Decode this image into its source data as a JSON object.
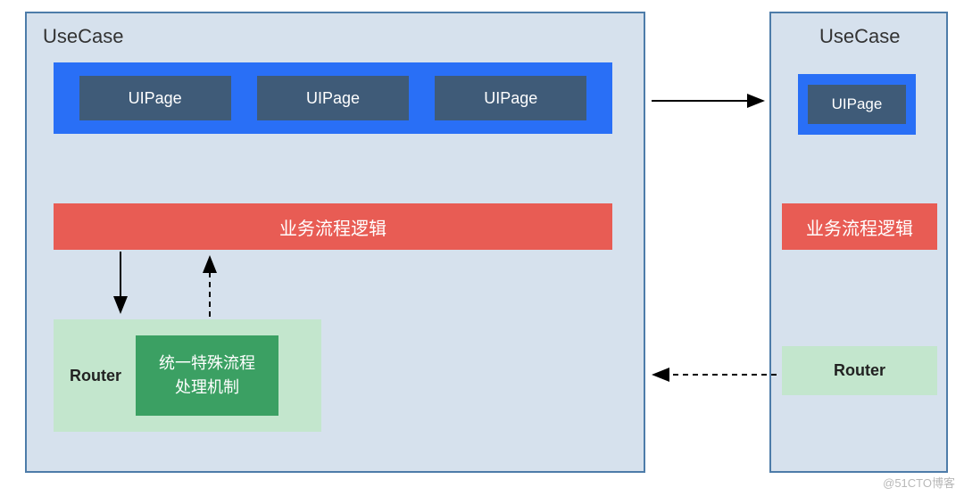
{
  "left": {
    "title": "UseCase",
    "uipages": [
      "UIPage",
      "UIPage",
      "UIPage"
    ],
    "logic": "业务流程逻辑",
    "router": {
      "label": "Router",
      "inner": "统一特殊流程\n处理机制"
    }
  },
  "right": {
    "title": "UseCase",
    "uipage": "UIPage",
    "logic": "业务流程逻辑",
    "router": "Router"
  },
  "watermark": "@51CTO博客"
}
